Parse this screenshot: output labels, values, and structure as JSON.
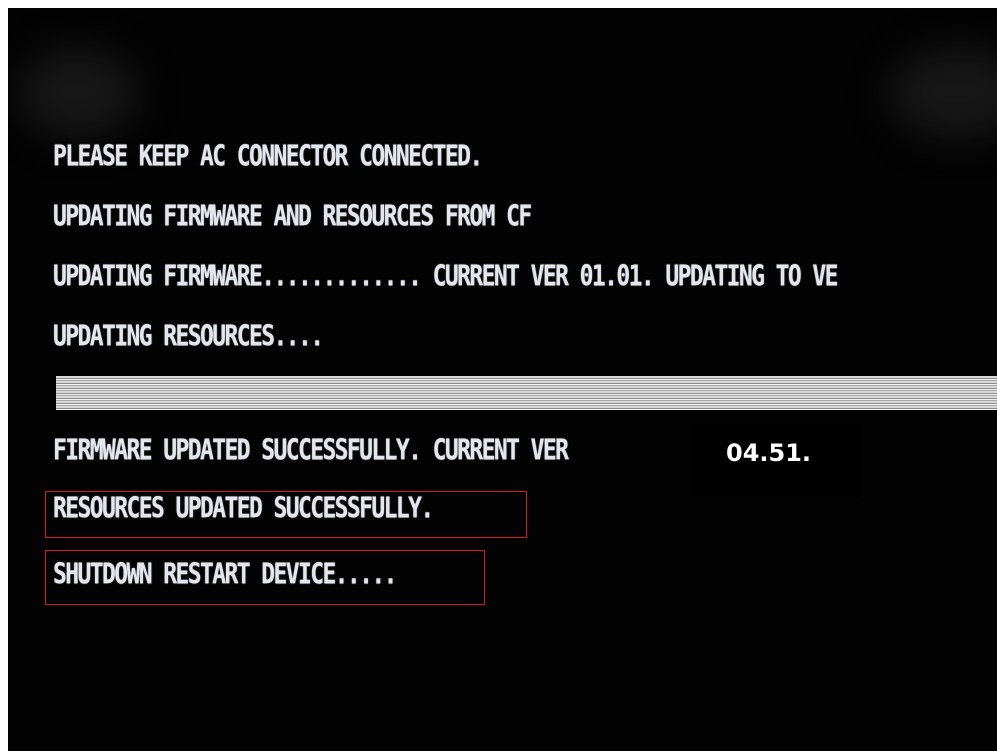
{
  "screen": {
    "lines": [
      "PLEASE KEEP AC CONNECTOR CONNECTED.",
      "UPDATING FIRMWARE AND RESOURCES FROM CF",
      "UPDATING FIRMWARE............. CURRENT VER 01.01. UPDATING TO VE",
      "UPDATING RESOURCES....",
      "FIRMWARE UPDATED SUCCESSFULLY. CURRENT VER",
      "RESOURCES UPDATED SUCCESSFULLY.",
      "SHUTDOWN RESTART DEVICE....."
    ],
    "version_overlay": "04.51.",
    "progress_fraction": 1.0
  },
  "colors": {
    "screen_background": "#030303",
    "text": "#e4e6ee",
    "highlight_border": "#d21a1a",
    "overlay_text": "#ffffff"
  }
}
